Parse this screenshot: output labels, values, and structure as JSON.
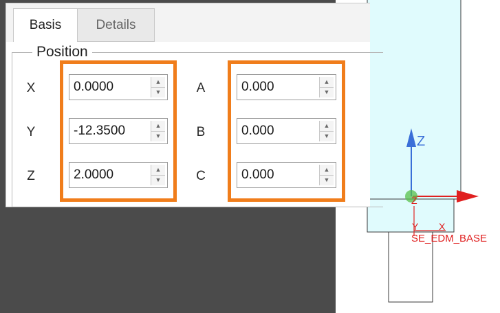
{
  "tabs": {
    "basis": "Basis",
    "details": "Details"
  },
  "position": {
    "legend": "Position",
    "translation": [
      {
        "axis": "X",
        "value": "0.0000"
      },
      {
        "axis": "Y",
        "value": "-12.3500"
      },
      {
        "axis": "Z",
        "value": "2.0000"
      }
    ],
    "rotation": [
      {
        "axis": "A",
        "value": "0.000"
      },
      {
        "axis": "B",
        "value": "0.000"
      },
      {
        "axis": "C",
        "value": "0.000"
      }
    ]
  },
  "spinner_icons": {
    "up": "caret-up-icon",
    "down": "caret-down-icon"
  },
  "viewport": {
    "csys_name": "SE_EDM_BASE",
    "triad": {
      "z": "Z",
      "y": "Y",
      "x": "X",
      "origin_label": "Z"
    }
  },
  "colors": {
    "highlight": "#f07d1b",
    "cad_fill": "#e0fbfd",
    "axis_z": "#3a6fd8",
    "axis_x": "#e02020",
    "origin": "#58c04a"
  }
}
